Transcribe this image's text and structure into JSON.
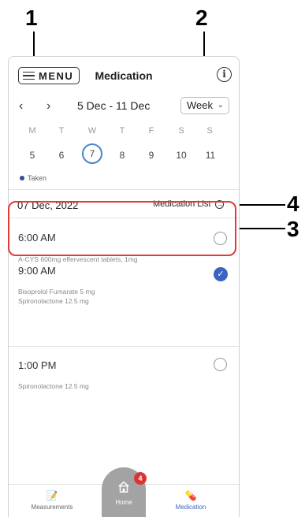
{
  "callouts": [
    "1",
    "2",
    "3",
    "4"
  ],
  "header": {
    "menu_label": "MENU",
    "title": "Medication",
    "info_icon": "i"
  },
  "week_nav": {
    "prev": "‹",
    "next": "›",
    "range": "5 Dec - 11 Dec",
    "view": "Week",
    "view_chevron": "⌄"
  },
  "days": [
    {
      "dow": "M",
      "num": "5"
    },
    {
      "dow": "T",
      "num": "6"
    },
    {
      "dow": "W",
      "num": "7"
    },
    {
      "dow": "T",
      "num": "8"
    },
    {
      "dow": "F",
      "num": "9"
    },
    {
      "dow": "S",
      "num": "10"
    },
    {
      "dow": "S",
      "num": "11"
    }
  ],
  "selected_day_index": 2,
  "legend": {
    "taken": "Taken"
  },
  "date_row": {
    "date": "07 Dec, 2022",
    "medication_list": "Medication List",
    "list_icon": "→"
  },
  "slots": [
    {
      "time": "6:00 AM",
      "meds": [
        "A-CYS 600mg effervescent tablets, 1mg"
      ],
      "taken": false
    },
    {
      "time": "9:00 AM",
      "meds": [
        "Bisoprolol Fumarate 5 mg",
        "Spironolactone 12.5 mg"
      ],
      "taken": true,
      "check": "✓"
    },
    {
      "time": "1:00 PM",
      "meds": [
        "Spironolactone 12.5 mg"
      ],
      "taken": false
    }
  ],
  "bottom_nav": {
    "measurements": "Measurements",
    "home": "Home",
    "home_badge": "4",
    "medication": "Medication"
  },
  "colors": {
    "accent_blue": "#4a86c8",
    "check_blue": "#3b63c4",
    "highlight_red": "#e23a3a",
    "badge_red": "#d93636",
    "home_grey": "#a3a3a3"
  }
}
